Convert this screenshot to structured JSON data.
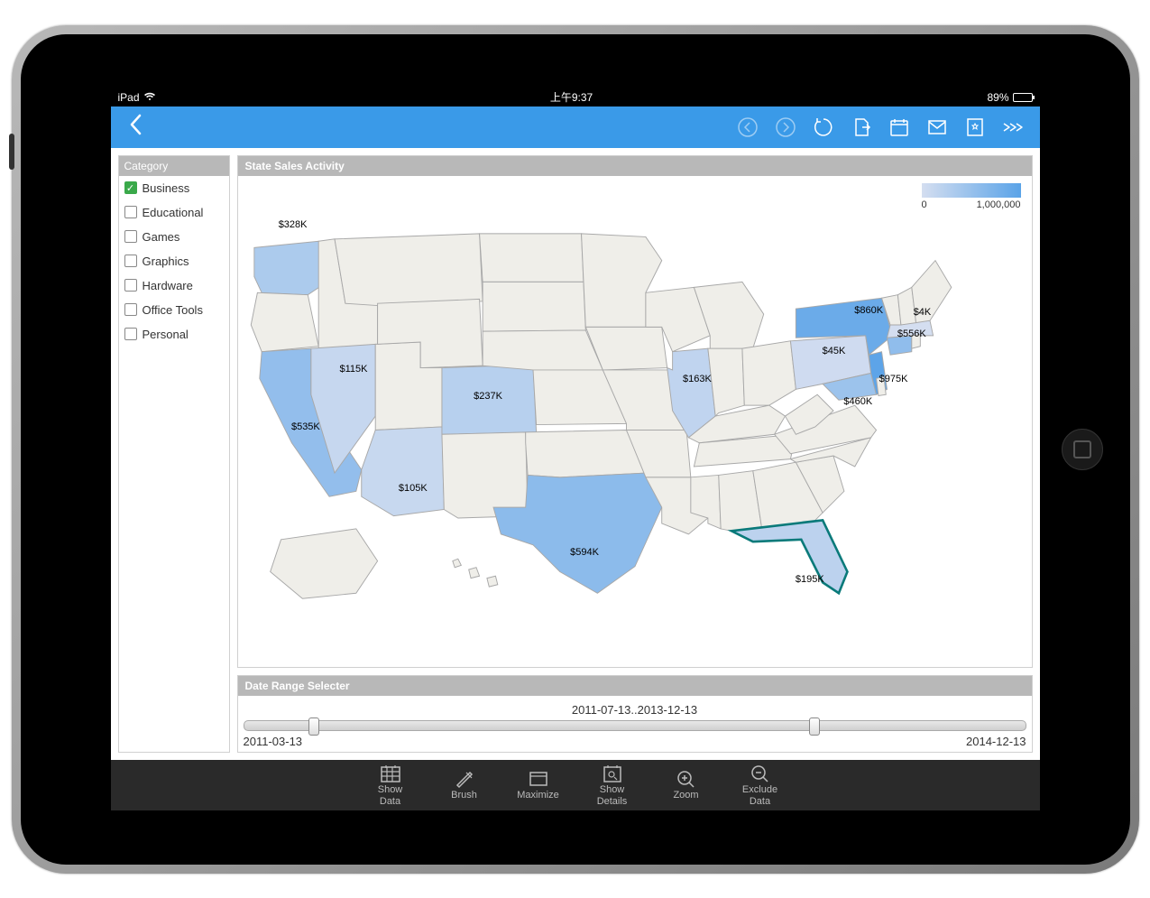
{
  "status": {
    "carrier": "iPad",
    "time": "上午9:37",
    "battery_pct": "89%"
  },
  "topbar": {
    "icons": [
      "back-icon",
      "history-back-icon",
      "history-forward-icon",
      "refresh-icon",
      "export-icon",
      "calendar-icon",
      "mail-icon",
      "bookmark-icon",
      "more-icon"
    ]
  },
  "sidebar": {
    "header": "Category",
    "items": [
      {
        "label": "Business",
        "checked": true
      },
      {
        "label": "Educational",
        "checked": false
      },
      {
        "label": "Games",
        "checked": false
      },
      {
        "label": "Graphics",
        "checked": false
      },
      {
        "label": "Hardware",
        "checked": false
      },
      {
        "label": "Office Tools",
        "checked": false
      },
      {
        "label": "Personal",
        "checked": false
      }
    ]
  },
  "map_panel": {
    "title": "State Sales Activity",
    "legend_min": "0",
    "legend_max": "1,000,000"
  },
  "chart_data": {
    "type": "choropleth",
    "title": "State Sales Activity",
    "legend_range": [
      0,
      1000000
    ],
    "value_format": "$K",
    "selected_state": "Florida",
    "states": [
      {
        "state": "Washington",
        "label": "$328K",
        "value": 328000
      },
      {
        "state": "Nevada",
        "label": "$115K",
        "value": 115000
      },
      {
        "state": "California",
        "label": "$535K",
        "value": 535000
      },
      {
        "state": "Arizona",
        "label": "$105K",
        "value": 105000
      },
      {
        "state": "Colorado",
        "label": "$237K",
        "value": 237000
      },
      {
        "state": "Texas",
        "label": "$594K",
        "value": 594000
      },
      {
        "state": "Illinois",
        "label": "$163K",
        "value": 163000
      },
      {
        "state": "Florida",
        "label": "$195K",
        "value": 195000
      },
      {
        "state": "Pennsylvania",
        "label": "$45K",
        "value": 45000
      },
      {
        "state": "Maryland",
        "label": "$460K",
        "value": 460000
      },
      {
        "state": "New Jersey",
        "label": "$975K",
        "value": 975000
      },
      {
        "state": "New York",
        "label": "$860K",
        "value": 860000
      },
      {
        "state": "Connecticut",
        "label": "$556K",
        "value": 556000
      },
      {
        "state": "Massachusetts",
        "label": "$4K",
        "value": 4000
      }
    ]
  },
  "date_panel": {
    "title": "Date Range Selecter",
    "range_label": "2011-07-13..2013-12-13",
    "min_label": "2011-03-13",
    "max_label": "2014-12-13",
    "handle_left_pct": 9,
    "handle_right_pct": 73
  },
  "tools": [
    {
      "label": "Show Data",
      "icon": "table-icon"
    },
    {
      "label": "Brush",
      "icon": "brush-icon"
    },
    {
      "label": "Maximize",
      "icon": "maximize-icon"
    },
    {
      "label": "Show Details",
      "icon": "details-icon"
    },
    {
      "label": "Zoom",
      "icon": "zoom-in-icon"
    },
    {
      "label": "Exclude Data",
      "icon": "zoom-out-icon"
    }
  ]
}
